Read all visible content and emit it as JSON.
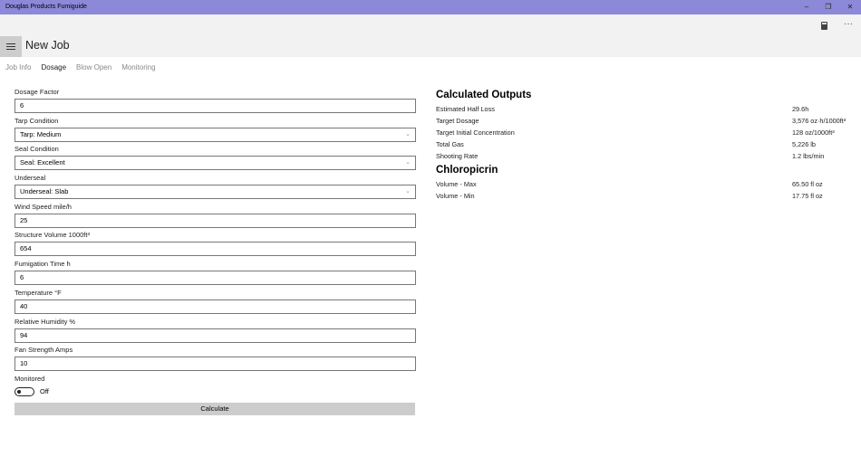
{
  "window": {
    "title": "Douglas Products Fumiguide",
    "minimize": "–",
    "maximize": "❐",
    "close": "✕"
  },
  "header": {
    "title": "New Job",
    "more": "···"
  },
  "tabs": [
    {
      "label": "Job Info"
    },
    {
      "label": "Dosage"
    },
    {
      "label": "Blow Open"
    },
    {
      "label": "Monitoring"
    }
  ],
  "form": {
    "fields": [
      {
        "label": "Dosage Factor",
        "value": "6",
        "type": "text"
      },
      {
        "label": "Tarp Condition",
        "value": "Tarp: Medium",
        "type": "select"
      },
      {
        "label": "Seal Condition",
        "value": "Seal: Excellent",
        "type": "select"
      },
      {
        "label": "Underseal",
        "value": "Underseal: Slab",
        "type": "select"
      },
      {
        "label": "Wind Speed  mile/h",
        "value": "25",
        "type": "text"
      },
      {
        "label": "Structure Volume  1000ft³",
        "value": "654",
        "type": "text"
      },
      {
        "label": "Fumigation Time  h",
        "value": "6",
        "type": "text"
      },
      {
        "label": "Temperature  °F",
        "value": "40",
        "type": "text"
      },
      {
        "label": "Relative Humidity %",
        "value": "94",
        "type": "text"
      },
      {
        "label": "Fan Strength Amps",
        "value": "10",
        "type": "text"
      }
    ],
    "monitored_label": "Monitored",
    "monitored_state": "Off",
    "calculate_label": "Calculate"
  },
  "outputs": {
    "title": "Calculated Outputs",
    "rows": [
      {
        "k": "Estimated Half Loss",
        "v": "29.6h"
      },
      {
        "k": "Target Dosage",
        "v": "3,576 oz·h/1000ft³"
      },
      {
        "k": "Target Initial Concentration",
        "v": "128 oz/1000ft³"
      },
      {
        "k": "Total Gas",
        "v": "5,226 lb"
      },
      {
        "k": "Shooting Rate",
        "v": "1.2 lbs/min"
      }
    ],
    "chloro_title": "Chloropicrin",
    "chloro_rows": [
      {
        "k": "Volume - Max",
        "v": "65.50 fl oz"
      },
      {
        "k": "Volume - Min",
        "v": "17.75 fl oz"
      }
    ]
  }
}
